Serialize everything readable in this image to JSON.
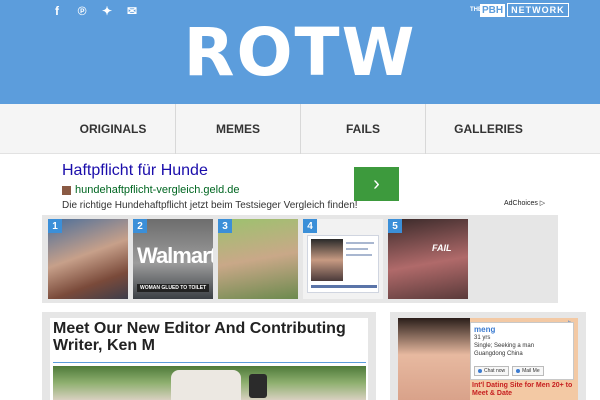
{
  "header": {
    "logo": "ROTW",
    "social": [
      {
        "name": "facebook-icon",
        "glyph": "f"
      },
      {
        "name": "pinterest-icon",
        "glyph": "℗"
      },
      {
        "name": "twitter-icon",
        "glyph": "✦"
      },
      {
        "name": "email-icon",
        "glyph": "✉"
      }
    ],
    "network": {
      "the": "THE",
      "pbh": "PBH",
      "label": "NETWORK"
    },
    "color": "#5c9ddc"
  },
  "nav": {
    "items": [
      "ORIGINALS",
      "MEMES",
      "FAILS",
      "GALLERIES"
    ]
  },
  "ad": {
    "title": "Haftpflicht für Hunde",
    "url": "hundehaftpflicht-vergleich.geld.de",
    "description": "Die richtige Hundehaftpflicht jetzt beim Testsieger Vergleich finden!",
    "button_glyph": "›",
    "adchoices": "AdChoices ▷"
  },
  "thumbnails": [
    {
      "num": "1"
    },
    {
      "num": "2",
      "text": "Walmart",
      "caption": "WOMAN GLUED TO TOILET"
    },
    {
      "num": "3"
    },
    {
      "num": "4"
    },
    {
      "num": "5",
      "text": "FAIL"
    }
  ],
  "article": {
    "title": "Meet Our New Editor And Contributing Writer, Ken M"
  },
  "sidebar_ad": {
    "name": "meng",
    "lines": [
      "31 yrs",
      "Single; Seeking a man",
      "Guangdong China"
    ],
    "chat": "Chat now",
    "mail": "Mail Me",
    "headline": "Int'l Dating Site for Men 20+ to Meet & Date",
    "close": "▷"
  }
}
